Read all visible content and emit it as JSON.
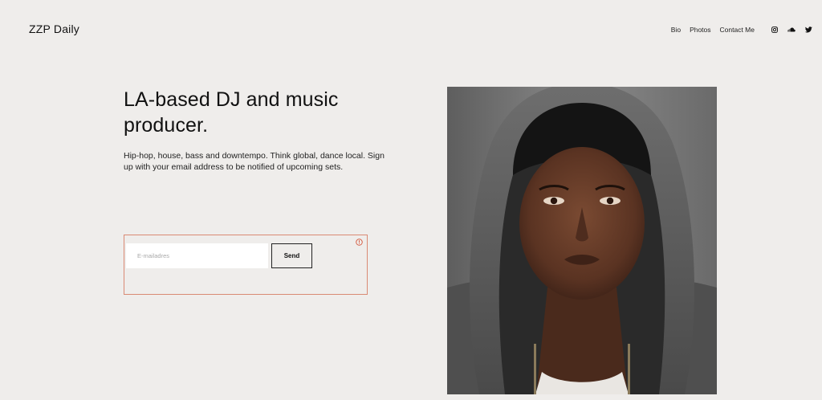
{
  "header": {
    "brand": "ZZP Daily",
    "nav": [
      {
        "label": "Bio"
      },
      {
        "label": "Photos"
      },
      {
        "label": "Contact Me"
      }
    ],
    "social_icons": [
      "instagram-icon",
      "soundcloud-icon",
      "twitter-icon"
    ]
  },
  "hero": {
    "headline": "LA-based DJ and music producer.",
    "description": "Hip-hop, house, bass and downtempo. Think global, dance local. Sign up with your email address to be notified of upcoming sets."
  },
  "signup": {
    "email_placeholder": "E-mailadres",
    "email_value": "",
    "send_label": "Send",
    "has_error": true
  },
  "colors": {
    "background": "#efedeb",
    "error_border": "#d98a74",
    "error_icon": "#d4553a",
    "text": "#111111"
  }
}
